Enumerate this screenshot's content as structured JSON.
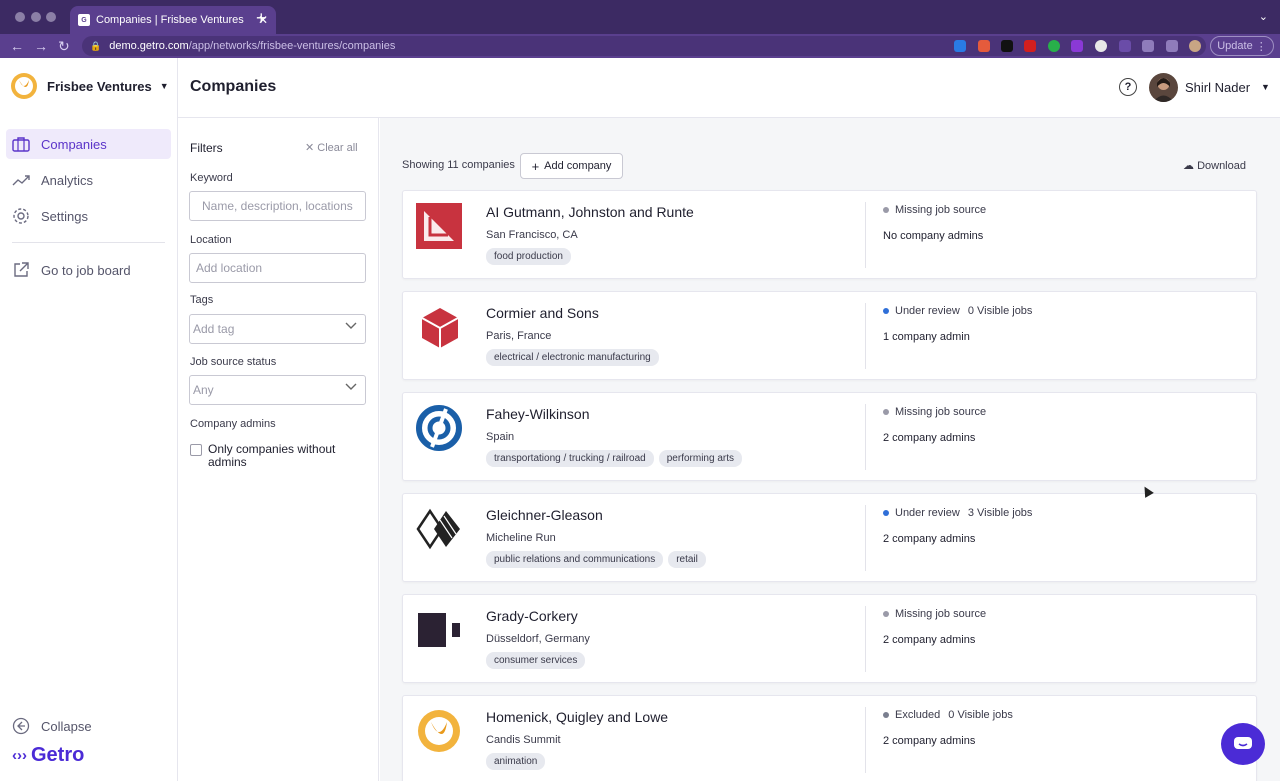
{
  "browser": {
    "tab_title": "Companies | Frisbee Ventures",
    "tab_favicon": "G",
    "url_host": "demo.getro.com",
    "url_path": "/app/networks/frisbee-ventures/companies",
    "update_label": "Update"
  },
  "sidebar": {
    "org_name": "Frisbee Ventures",
    "items": [
      {
        "label": "Companies",
        "icon": "briefcase-icon",
        "active": true
      },
      {
        "label": "Analytics",
        "icon": "trend-icon",
        "active": false
      },
      {
        "label": "Settings",
        "icon": "gear-icon",
        "active": false
      }
    ],
    "job_board_label": "Go to job board",
    "collapse_label": "Collapse",
    "brand": "Getro"
  },
  "header": {
    "title": "Companies",
    "help_glyph": "?",
    "user_name": "Shirl Nader"
  },
  "filters": {
    "heading": "Filters",
    "clear_all": "Clear all",
    "keyword_label": "Keyword",
    "keyword_placeholder": "Name, description, locations",
    "location_label": "Location",
    "location_placeholder": "Add location",
    "tags_label": "Tags",
    "tags_placeholder": "Add tag",
    "job_source_label": "Job source status",
    "job_source_value": "Any",
    "admins_label": "Company admins",
    "checkbox_label": "Only companies without admins"
  },
  "list": {
    "showing": "Showing 11 companies",
    "add_company": "Add company",
    "download": "Download",
    "companies": [
      {
        "name": "AI Gutmann, Johnston and Runte",
        "location": "San Francisco, CA",
        "tags": [
          "food production"
        ],
        "status": "Missing job source",
        "status_color": "#9a9aa8",
        "jobs": "",
        "admins": "No company admins"
      },
      {
        "name": "Cormier and Sons",
        "location": "Paris, France",
        "tags": [
          "electrical / electronic manufacturing"
        ],
        "status": "Under review",
        "status_color": "#2f6fd8",
        "jobs": "0 Visible jobs",
        "admins": "1 company admin"
      },
      {
        "name": "Fahey-Wilkinson",
        "location": "Spain",
        "tags": [
          "transportationg / trucking / railroad",
          "performing arts"
        ],
        "status": "Missing job source",
        "status_color": "#9a9aa8",
        "jobs": "",
        "admins": "2 company admins"
      },
      {
        "name": "Gleichner-Gleason",
        "location": "Micheline Run",
        "tags": [
          "public relations and communications",
          "retail"
        ],
        "status": "Under review",
        "status_color": "#2f6fd8",
        "jobs": "3 Visible jobs",
        "admins": "2 company admins"
      },
      {
        "name": "Grady-Corkery",
        "location": "Düsseldorf, Germany",
        "tags": [
          "consumer services"
        ],
        "status": "Missing job source",
        "status_color": "#9a9aa8",
        "jobs": "",
        "admins": "2 company admins"
      },
      {
        "name": "Homenick, Quigley and Lowe",
        "location": "Candis Summit",
        "tags": [
          "animation"
        ],
        "status": "Excluded",
        "status_color": "#7a7f8f",
        "jobs": "0 Visible jobs",
        "admins": "2 company admins"
      }
    ]
  },
  "colors": {
    "accent": "#5b34c9",
    "brand": "#4b2bd6",
    "browser_chrome": "#3c2a63"
  }
}
